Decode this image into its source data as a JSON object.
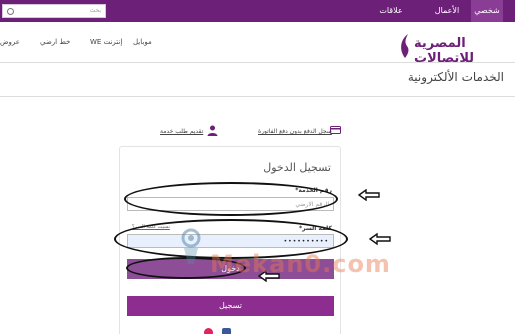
{
  "topbar": {
    "search_placeholder": "بحث",
    "tabs": [
      {
        "label": "شخصي",
        "active": true
      },
      {
        "label": "الأعمال",
        "active": false
      },
      {
        "label": "علاقات المستثمرين",
        "active": false
      }
    ]
  },
  "brand": {
    "logo_text": "المصرية للاتصالات",
    "color": "#6d2077"
  },
  "nav": {
    "items": [
      "موبايل",
      "WE إنترنت",
      "خط ارضي",
      "عروض"
    ]
  },
  "page_title": "الخدمات الألكترونية",
  "links": {
    "pay_bill": "سجل الدفع بدون دفع الفاتورة",
    "service_request": "تقديم طلب خدمة"
  },
  "login": {
    "title": "تسجيل الدخول",
    "service_number_label": "رقم الخدمة*",
    "service_number_placeholder": "الرقم الارضي",
    "password_label": "كلمة السر*",
    "password_value": "••••••••••",
    "forgot_label": "نسيت كلمة السر؟",
    "login_button": "دخول",
    "register_button": "تسجيل"
  },
  "watermark": "Mekan0.com",
  "colors": {
    "primary": "#6d2077",
    "button": "#8d2d8f",
    "accent_watermark": "#e87850"
  }
}
